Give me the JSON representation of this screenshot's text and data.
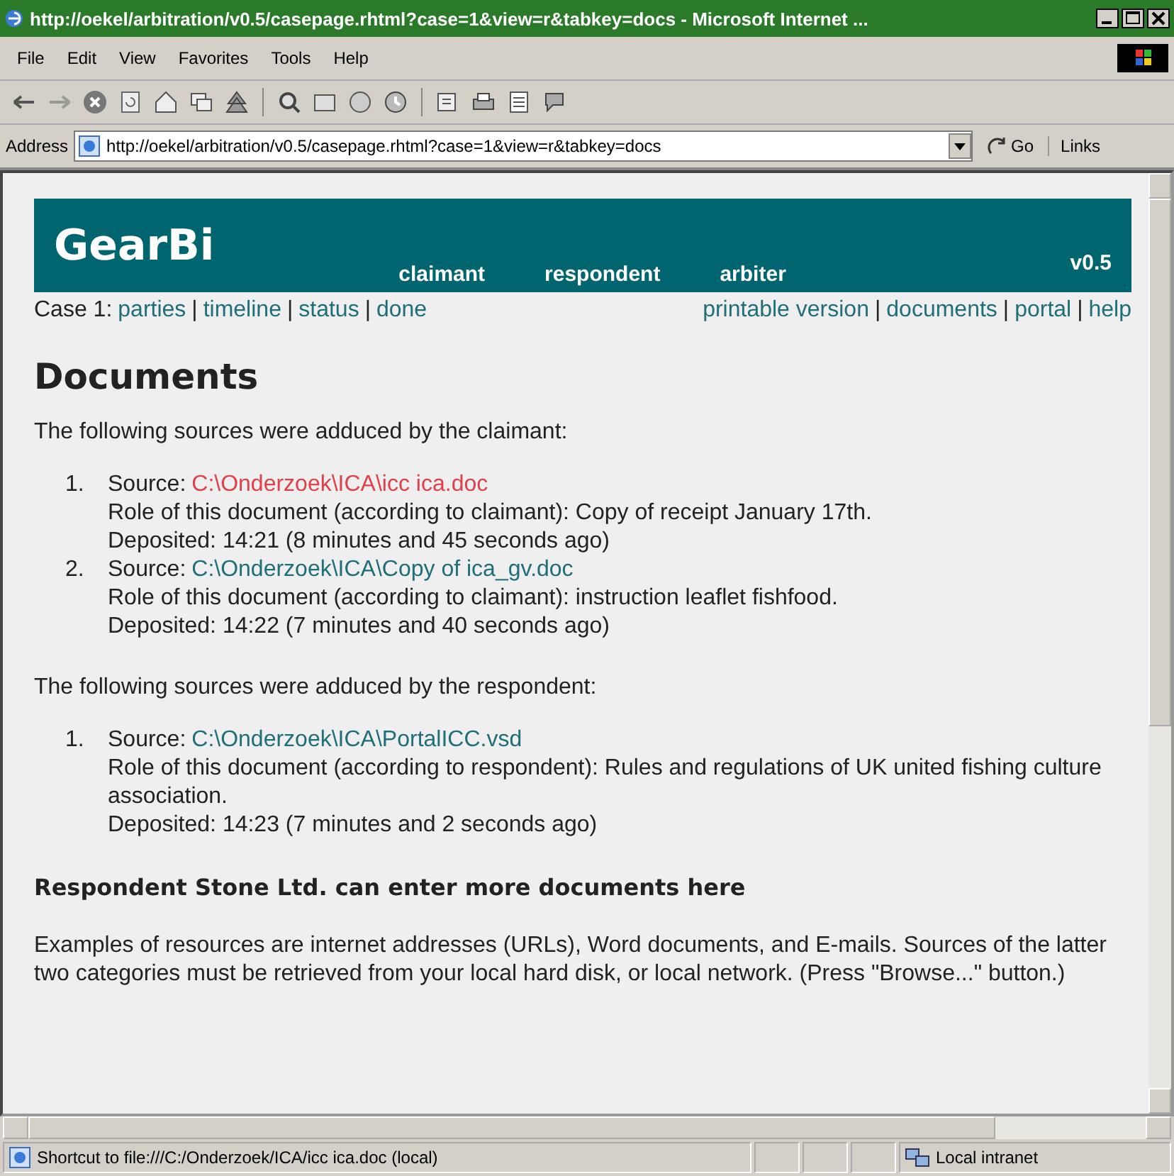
{
  "window": {
    "title": "http://oekel/arbitration/v0.5/casepage.rhtml?case=1&view=r&tabkey=docs - Microsoft Internet ..."
  },
  "menu": [
    "File",
    "Edit",
    "View",
    "Favorites",
    "Tools",
    "Help"
  ],
  "address": {
    "label": "Address",
    "value": "http://oekel/arbitration/v0.5/casepage.rhtml?case=1&view=r&tabkey=docs",
    "go": "Go",
    "links": "Links"
  },
  "header": {
    "logo": "GearBi",
    "roles": [
      "claimant",
      "respondent",
      "arbiter"
    ],
    "version": "v0.5"
  },
  "nav": {
    "label": "Case 1:",
    "left": [
      {
        "kind": "link",
        "text": "parties"
      },
      {
        "kind": "separator",
        "text": "|"
      },
      {
        "kind": "link",
        "text": "timeline"
      },
      {
        "kind": "separator",
        "text": "|"
      },
      {
        "kind": "link",
        "text": "status"
      },
      {
        "kind": "separator",
        "text": "|"
      },
      {
        "kind": "link",
        "text": "done"
      }
    ],
    "right": [
      {
        "kind": "link",
        "text": "printable version"
      },
      {
        "kind": "separator",
        "text": "|"
      },
      {
        "kind": "link",
        "text": "documents"
      },
      {
        "kind": "separator",
        "text": "|"
      },
      {
        "kind": "link",
        "text": "portal"
      },
      {
        "kind": "separator",
        "text": "|"
      },
      {
        "kind": "link",
        "text": "help"
      }
    ]
  },
  "page": {
    "heading": "Documents",
    "sections": [
      {
        "intro": "The following sources were adduced by the claimant:",
        "items": [
          {
            "number": "1.",
            "source_label": "Source:",
            "source": "C:\\Onderzoek\\ICA\\icc ica.doc",
            "hovered": true,
            "role": "Role of this document (according to claimant): Copy of receipt January 17th.",
            "deposited": "Deposited: 14:21 (8 minutes and 45 seconds ago)"
          },
          {
            "number": "2.",
            "source_label": "Source:",
            "source": "C:\\Onderzoek\\ICA\\Copy of ica_gv.doc",
            "hovered": false,
            "role": "Role of this document (according to claimant): instruction leaflet fishfood.",
            "deposited": "Deposited: 14:22 (7 minutes and 40 seconds ago)"
          }
        ]
      },
      {
        "intro": "The following sources were adduced by the respondent:",
        "items": [
          {
            "number": "1.",
            "source_label": "Source:",
            "source": "C:\\Onderzoek\\ICA\\PortalICC.vsd",
            "hovered": false,
            "role": "Role of this document (according to respondent): Rules and regulations of UK united fishing culture association.",
            "deposited": "Deposited: 14:23 (7 minutes and 2 seconds ago)"
          }
        ]
      }
    ],
    "subheading": "Respondent Stone Ltd. can enter more documents here",
    "paragraph": "Examples of resources are internet addresses (URLs), Word documents, and E-mails. Sources of the latter two categories must be retrieved from your local hard disk, or local network. (Press \"Browse...\" button.)"
  },
  "status_bar": {
    "text": "Shortcut to file:///C:/Onderzoek/ICA/icc ica.doc (local)",
    "zone": "Local intranet"
  }
}
